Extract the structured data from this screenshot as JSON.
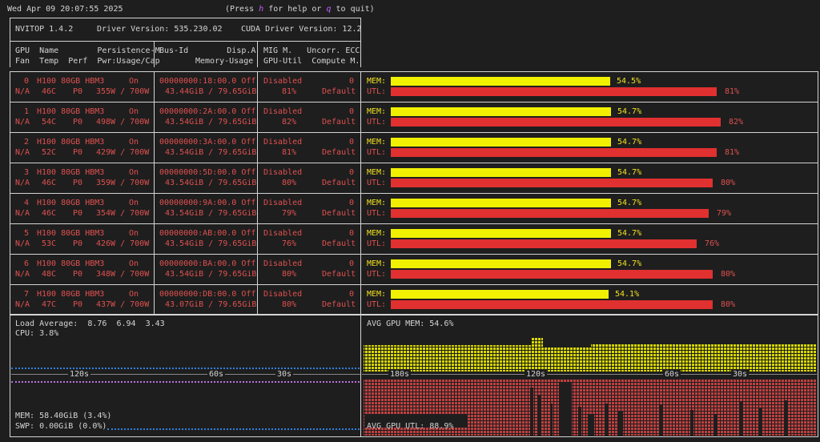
{
  "header": {
    "datetime": "Wed Apr 09 20:07:55 2025",
    "help_prefix": "(Press ",
    "help_key": "h",
    "help_middle": " for help or ",
    "quit_key": "q",
    "help_suffix": " to quit)"
  },
  "info": {
    "nvitop": "NVITOP 1.4.2",
    "driver": "Driver Version: 535.230.02",
    "cuda": "CUDA Driver Version: 12.2"
  },
  "columns": {
    "c1a": "GPU  Name        Persistence-M",
    "c1b": "Fan  Temp  Perf  Pwr:Usage/Cap",
    "c2a": "Bus-Id        Disp.A",
    "c2b": "Memory-Usage",
    "c3a": "MIG M.   Uncorr. ECC",
    "c3b": "GPU-Util  Compute M."
  },
  "gpus": [
    {
      "idx": "0",
      "name": "H100 80GB HBM3",
      "pers": "On",
      "fan": "N/A",
      "temp": "46C",
      "perf": "P0",
      "power": "355W / 700W",
      "bus": "00000000:18:00.0 Off",
      "mem": "43.44GiB / 79.65GiB",
      "mig": "Disabled",
      "ecc": "0",
      "util": "81%",
      "compute": "Default",
      "mem_pct": "54.5%",
      "util_pct": "81%",
      "mem_val": 54.5,
      "util_val": 81
    },
    {
      "idx": "1",
      "name": "H100 80GB HBM3",
      "pers": "On",
      "fan": "N/A",
      "temp": "54C",
      "perf": "P0",
      "power": "498W / 700W",
      "bus": "00000000:2A:00.0 Off",
      "mem": "43.54GiB / 79.65GiB",
      "mig": "Disabled",
      "ecc": "0",
      "util": "82%",
      "compute": "Default",
      "mem_pct": "54.7%",
      "util_pct": "82%",
      "mem_val": 54.7,
      "util_val": 82
    },
    {
      "idx": "2",
      "name": "H100 80GB HBM3",
      "pers": "On",
      "fan": "N/A",
      "temp": "52C",
      "perf": "P0",
      "power": "429W / 700W",
      "bus": "00000000:3A:00.0 Off",
      "mem": "43.54GiB / 79.65GiB",
      "mig": "Disabled",
      "ecc": "0",
      "util": "81%",
      "compute": "Default",
      "mem_pct": "54.7%",
      "util_pct": "81%",
      "mem_val": 54.7,
      "util_val": 81
    },
    {
      "idx": "3",
      "name": "H100 80GB HBM3",
      "pers": "On",
      "fan": "N/A",
      "temp": "46C",
      "perf": "P0",
      "power": "359W / 700W",
      "bus": "00000000:5D:00.0 Off",
      "mem": "43.54GiB / 79.65GiB",
      "mig": "Disabled",
      "ecc": "0",
      "util": "80%",
      "compute": "Default",
      "mem_pct": "54.7%",
      "util_pct": "80%",
      "mem_val": 54.7,
      "util_val": 80
    },
    {
      "idx": "4",
      "name": "H100 80GB HBM3",
      "pers": "On",
      "fan": "N/A",
      "temp": "46C",
      "perf": "P0",
      "power": "354W / 700W",
      "bus": "00000000:9A:00.0 Off",
      "mem": "43.54GiB / 79.65GiB",
      "mig": "Disabled",
      "ecc": "0",
      "util": "79%",
      "compute": "Default",
      "mem_pct": "54.7%",
      "util_pct": "79%",
      "mem_val": 54.7,
      "util_val": 79
    },
    {
      "idx": "5",
      "name": "H100 80GB HBM3",
      "pers": "On",
      "fan": "N/A",
      "temp": "53C",
      "perf": "P0",
      "power": "426W / 700W",
      "bus": "00000000:AB:00.0 Off",
      "mem": "43.54GiB / 79.65GiB",
      "mig": "Disabled",
      "ecc": "0",
      "util": "76%",
      "compute": "Default",
      "mem_pct": "54.7%",
      "util_pct": "76%",
      "mem_val": 54.7,
      "util_val": 76
    },
    {
      "idx": "6",
      "name": "H100 80GB HBM3",
      "pers": "On",
      "fan": "N/A",
      "temp": "48C",
      "perf": "P0",
      "power": "348W / 700W",
      "bus": "00000000:BA:00.0 Off",
      "mem": "43.54GiB / 79.65GiB",
      "mig": "Disabled",
      "ecc": "0",
      "util": "80%",
      "compute": "Default",
      "mem_pct": "54.7%",
      "util_pct": "80%",
      "mem_val": 54.7,
      "util_val": 80
    },
    {
      "idx": "7",
      "name": "H100 80GB HBM3",
      "pers": "On",
      "fan": "N/A",
      "temp": "47C",
      "perf": "P0",
      "power": "437W / 700W",
      "bus": "00000000:DB:00.0 Off",
      "mem": "43.07GiB / 79.65GiB",
      "mig": "Disabled",
      "ecc": "0",
      "util": "80%",
      "compute": "Default",
      "mem_pct": "54.1%",
      "util_pct": "80%",
      "mem_val": 54.1,
      "util_val": 80
    }
  ],
  "bar_labels": {
    "mem": "MEM:",
    "utl": "UTL:"
  },
  "colors": {
    "mem": "#f0f000",
    "util": "#e03030",
    "cpu": "#3080e0",
    "host_mem": "#c070e0",
    "red_text": "#e05050"
  },
  "host": {
    "load_label": "Load Average:",
    "load_values": "8.76  6.94  3.43",
    "cpu": "CPU: 3.8%",
    "mem": "MEM: 58.40GiB (3.4%)",
    "swp": "SWP: 0.00GiB (0.0%)",
    "axis": [
      "120s",
      "60s",
      "30s"
    ]
  },
  "gpu_summary": {
    "avg_mem": "AVG GPU MEM: 54.6%",
    "avg_util": "AVG GPU UTL: 88.9%",
    "axis": [
      "180s",
      "120s",
      "60s",
      "30s"
    ]
  }
}
